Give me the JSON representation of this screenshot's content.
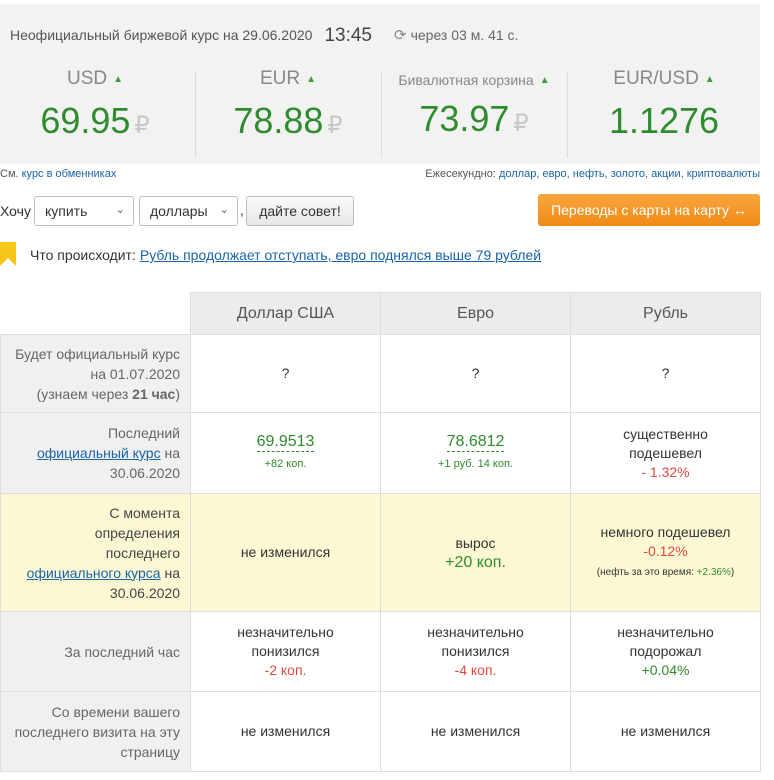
{
  "header": {
    "title": "Неофициальный биржевой курс на 29.06.2020",
    "time": "13:45",
    "countdown": "через 03 м. 41 с."
  },
  "rates": [
    {
      "label": "USD",
      "value": "69.95",
      "currency_sign": "₽",
      "trend": "▲"
    },
    {
      "label": "EUR",
      "value": "78.88",
      "currency_sign": "₽",
      "trend": "▲"
    },
    {
      "label": "Бивалютная корзина",
      "value": "73.97",
      "currency_sign": "₽",
      "trend": "▲"
    },
    {
      "label": "EUR/USD",
      "value": "1.1276",
      "trend": "▲"
    }
  ],
  "links": {
    "see_prefix": "См.",
    "exchange_link": "курс в обменниках",
    "every_second_prefix": "Ежесекундно:",
    "items": [
      "доллар",
      "евро",
      "нефть",
      "золото",
      "акции",
      "криптовалюты"
    ]
  },
  "advise": {
    "want_label": "Хочу",
    "action_select": "купить",
    "currency_select": "доллары",
    "comma": ",",
    "advice_button": "дайте совет!",
    "transfer_button": "Переводы с карты на карту ↔"
  },
  "news": {
    "label": "Что происходит:",
    "link": "Рубль продолжает отступать, евро поднялся выше 79 рублей"
  },
  "table": {
    "columns": [
      "Доллар США",
      "Евро",
      "Рубль"
    ],
    "row1": {
      "label_a": "Будет официальный курс на 01.07.2020",
      "label_b": "(узнаем через ",
      "label_bold": "21 час",
      "label_c": ")",
      "values": [
        "?",
        "?",
        "?"
      ]
    },
    "row2": {
      "label_a": "Последний",
      "label_link": "официальный курс",
      "label_b": "на 30.06.2020",
      "usd": "69.9513",
      "usd_change": "+82 коп.",
      "eur": "78.6812",
      "eur_change": "+1 руб. 14 коп.",
      "rub_text": "существенно подешевел",
      "rub_change": "- 1.32%"
    },
    "row3": {
      "label_a": "С момента определения последнего",
      "label_link": "официального курса",
      "label_b": "на 30.06.2020",
      "usd": "не изменился",
      "eur_text": "вырос",
      "eur_change": "+20 коп.",
      "rub_text": "немного подешевел",
      "rub_change": "-0.12%",
      "oil_prefix": "(нефть за это время:",
      "oil_value": "+2.36%",
      "oil_suffix": ")"
    },
    "row4": {
      "label": "За последний час",
      "usd_text": "незначительно понизился",
      "usd_change": "-2 коп.",
      "eur_text": "незначительно понизился",
      "eur_change": "-4 коп.",
      "rub_text": "незначительно подорожал",
      "rub_change": "+0.04%"
    },
    "row5": {
      "label": "Со времени вашего последнего визита на эту страницу",
      "values": [
        "не изменился",
        "не изменился",
        "не изменился"
      ]
    }
  }
}
